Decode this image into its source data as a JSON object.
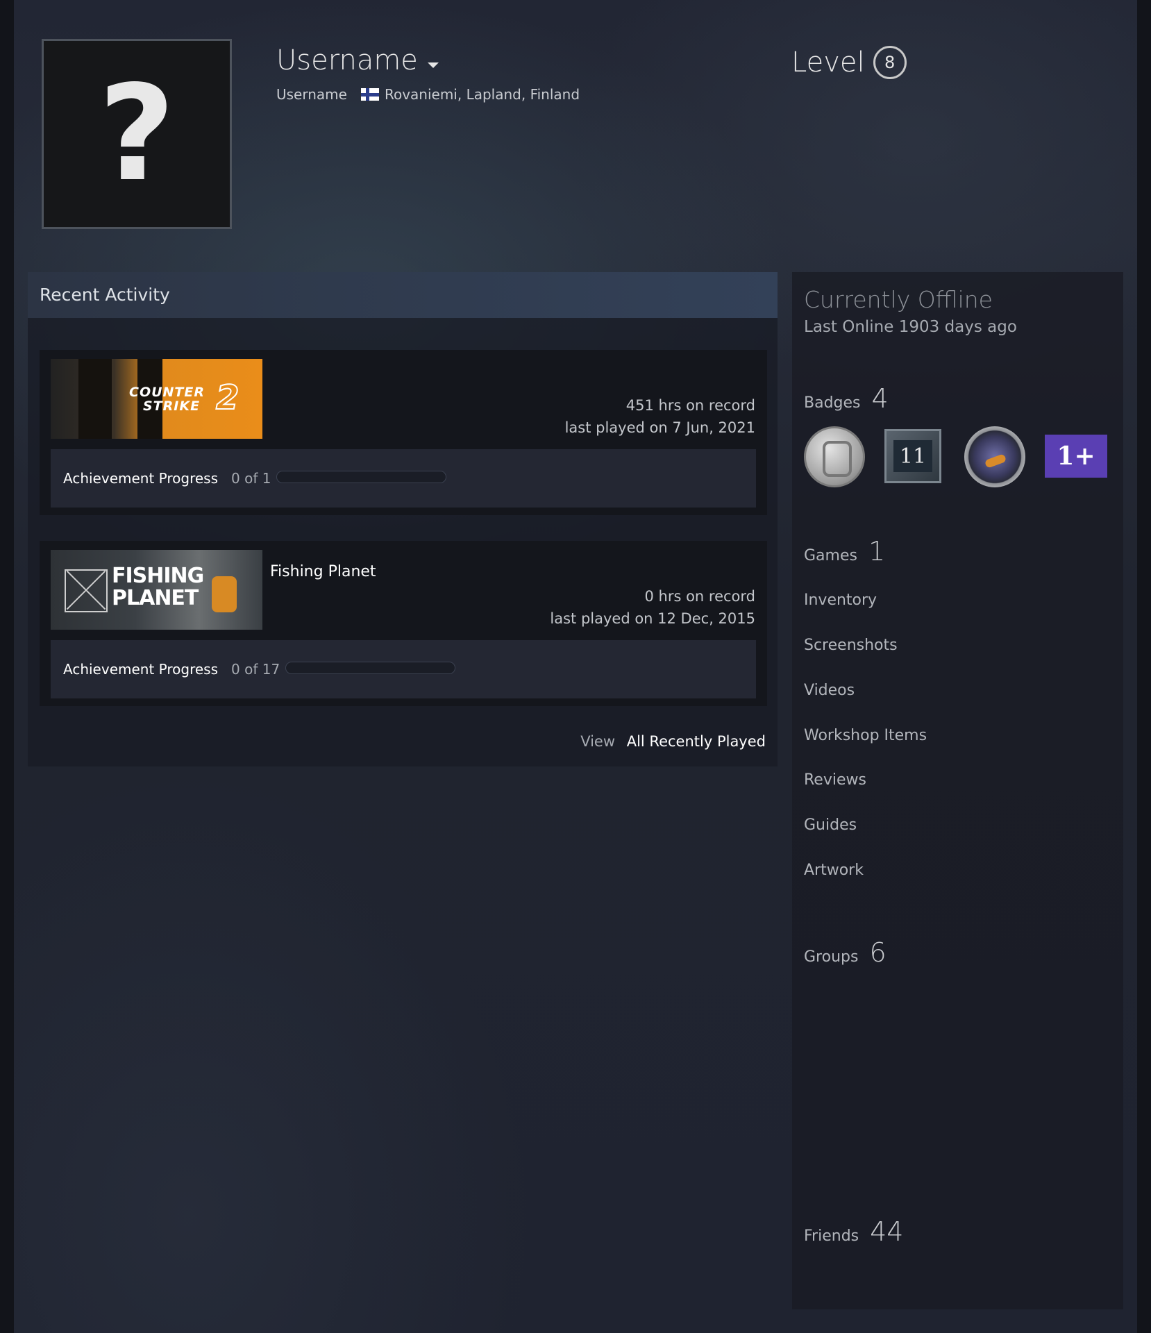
{
  "profile": {
    "persona_name": "Username",
    "real_name": "Username",
    "location": "Rovaniemi, Lapland, Finland",
    "avatar_glyph": "?",
    "level_label": "Level",
    "level": "8"
  },
  "activity": {
    "title": "Recent Activity",
    "games": [
      {
        "name": "",
        "capsule_text": [
          "COUNTER",
          "STRIKE",
          "2"
        ],
        "hours": "451 hrs on record",
        "last_played": "last played on 7 Jun, 2021",
        "achievement_label": "Achievement Progress",
        "achievement_count": "0 of 1",
        "achievement_progress": 0
      },
      {
        "name": "Fishing Planet",
        "capsule_text": [
          "FISHING",
          "PLANET"
        ],
        "hours": "0 hrs on record",
        "last_played": "last played on 12 Dec, 2015",
        "achievement_label": "Achievement Progress",
        "achievement_count": "0 of 17",
        "achievement_progress": 0
      }
    ],
    "view_word": "View",
    "view_link": "All Recently Played"
  },
  "sidebar": {
    "status": "Currently Offline",
    "last_online": "Last Online 1903 days ago",
    "badges_label": "Badges",
    "badges_count": "4",
    "badge_numbers": [
      "11",
      "1+"
    ],
    "games_label": "Games",
    "games_count": "1",
    "links": [
      "Inventory",
      "Screenshots",
      "Videos",
      "Workshop Items",
      "Reviews",
      "Guides",
      "Artwork"
    ],
    "groups_label": "Groups",
    "groups_count": "6",
    "friends_label": "Friends",
    "friends_count": "44"
  },
  "colors": {
    "background": "#1c2029",
    "panel": "#14161c",
    "accent_orange": "#e08a1c",
    "badge_purple": "#5a3fb3"
  }
}
